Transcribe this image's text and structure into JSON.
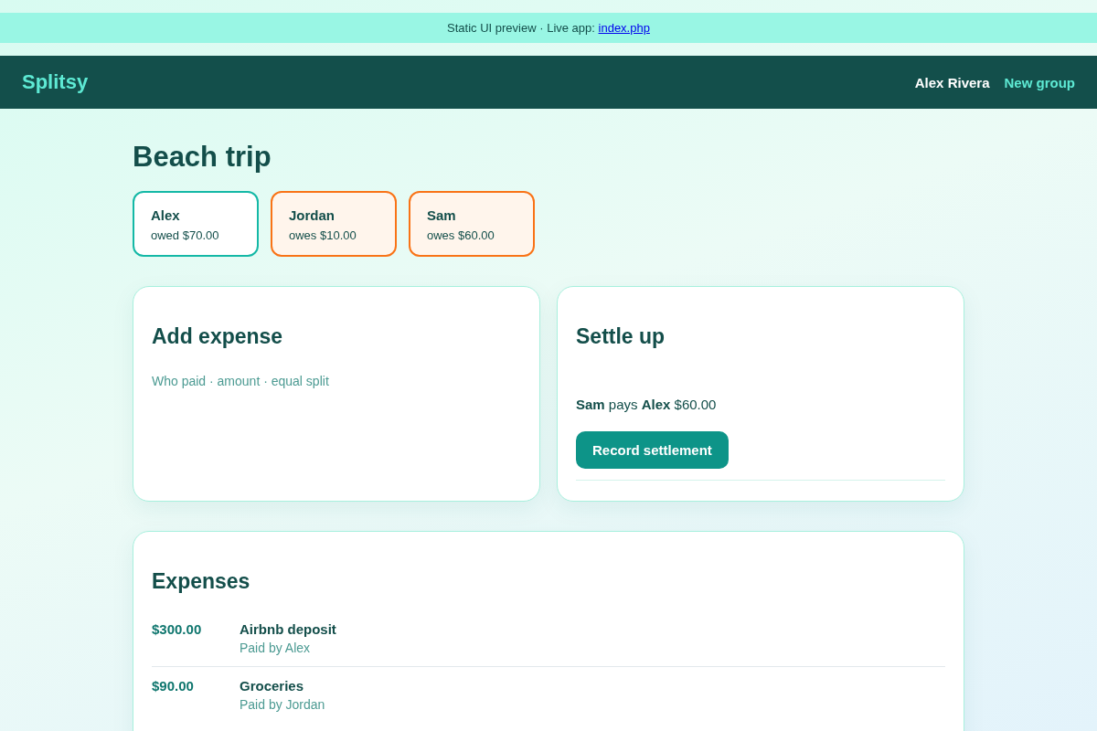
{
  "banner": {
    "text": "Static UI preview · Live app: ",
    "link": "index.php"
  },
  "header": {
    "brand": "Splitsy",
    "user": "Alex Rivera",
    "new_group": "New group"
  },
  "group": {
    "title": "Beach trip"
  },
  "members": [
    {
      "name": "Alex",
      "balance": "owed $70.00",
      "kind": "creditor"
    },
    {
      "name": "Jordan",
      "balance": "owes $10.00",
      "kind": "debtor"
    },
    {
      "name": "Sam",
      "balance": "owes $60.00",
      "kind": "debtor"
    }
  ],
  "add_expense": {
    "title": "Add expense",
    "hint": "Who paid · amount · equal split"
  },
  "settle_up": {
    "title": "Settle up",
    "suggestions": [
      "**Sam** pays **Alex** $60.00"
    ],
    "button": "Record settlement"
  },
  "expenses": {
    "title": "Expenses",
    "rows": [
      {
        "amount": "$300.00",
        "title": "Airbnb deposit",
        "paid_by": "Paid by Alex"
      },
      {
        "amount": "$90.00",
        "title": "Groceries",
        "paid_by": "Paid by Jordan"
      }
    ]
  }
}
